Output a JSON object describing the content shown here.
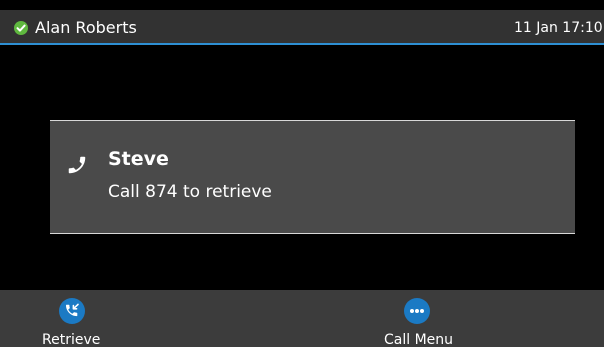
{
  "status_bar": {
    "user_name": "Alan Roberts",
    "datetime": "11 Jan 17:10",
    "presence_icon": "available-check-icon",
    "presence_color": "#5fb83f",
    "accent_color": "#2e8fd3"
  },
  "parked_call": {
    "icon": "handset-icon",
    "caller_name": "Steve",
    "instructions": "Call 874 to retrieve"
  },
  "softkeys": [
    {
      "label": "Retrieve",
      "icon": "call-retrieve-icon"
    },
    {
      "label": "Call Menu",
      "icon": "more-options-icon"
    }
  ]
}
